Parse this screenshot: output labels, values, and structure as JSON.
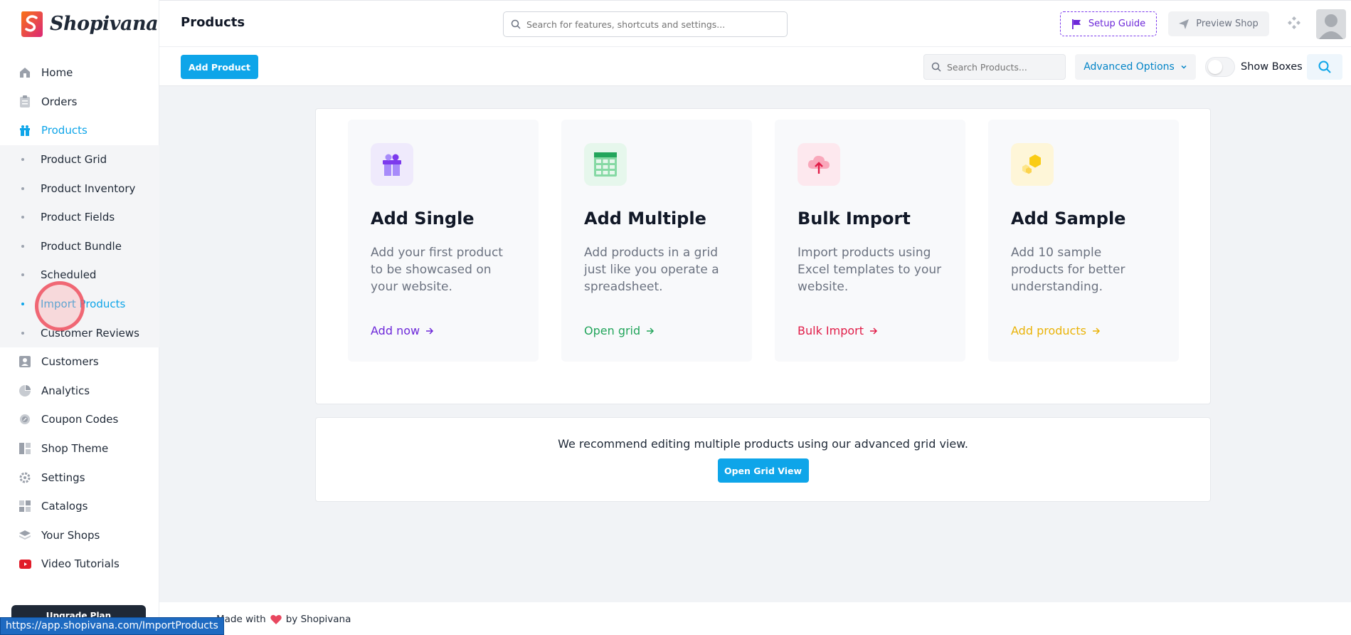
{
  "brand": {
    "name": "Shopivana"
  },
  "header": {
    "title": "Products",
    "search_placeholder": "Search for features, shortcuts and settings...",
    "setup_guide": "Setup Guide",
    "preview_shop": "Preview Shop"
  },
  "toolbar": {
    "add_product": "Add Product",
    "search_placeholder": "Search Products...",
    "advanced_options": "Advanced Options",
    "show_boxes": "Show Boxes"
  },
  "sidebar": {
    "items": [
      {
        "label": "Home",
        "icon": "home-icon"
      },
      {
        "label": "Orders",
        "icon": "clipboard-icon"
      },
      {
        "label": "Products",
        "icon": "gift-icon",
        "active": true
      },
      {
        "label": "Customers",
        "icon": "user-card-icon"
      },
      {
        "label": "Analytics",
        "icon": "pie-chart-icon"
      },
      {
        "label": "Coupon Codes",
        "icon": "badge-icon"
      },
      {
        "label": "Shop Theme",
        "icon": "layout-icon"
      },
      {
        "label": "Settings",
        "icon": "gear-icon"
      },
      {
        "label": "Catalogs",
        "icon": "grid-icon"
      },
      {
        "label": "Your Shops",
        "icon": "layers-icon"
      },
      {
        "label": "Video Tutorials",
        "icon": "youtube-icon"
      }
    ],
    "sub_items": [
      {
        "label": "Product Grid"
      },
      {
        "label": "Product Inventory"
      },
      {
        "label": "Product Fields"
      },
      {
        "label": "Product Bundle"
      },
      {
        "label": "Scheduled"
      },
      {
        "label": "Import Products",
        "active": true
      },
      {
        "label": "Customer Reviews"
      }
    ],
    "upgrade": "Upgrade Plan"
  },
  "cards": [
    {
      "title": "Add Single",
      "desc": "Add your first product to be showcased on your website.",
      "link": "Add now",
      "color": "#6d28d9",
      "icon": "gift-icon"
    },
    {
      "title": "Add Multiple",
      "desc": "Add products in a grid just like you operate a spreadsheet.",
      "link": "Open grid",
      "color": "#22a55b",
      "icon": "spreadsheet-icon"
    },
    {
      "title": "Bulk Import",
      "desc": "Import products using Excel templates to your website.",
      "link": "Bulk Import",
      "color": "#e11d48",
      "icon": "cloud-upload-icon"
    },
    {
      "title": "Add Sample",
      "desc": "Add 10 sample products for better understanding.",
      "link": "Add products",
      "color": "#eab308",
      "icon": "hexagon-icon"
    }
  ],
  "recommend": {
    "text": "We recommend editing multiple products using our advanced grid view.",
    "button": "Open Grid View"
  },
  "footer": {
    "made_with": "Made with",
    "by": "by Shopivana"
  },
  "status_url": "https://app.shopivana.com/ImportProducts",
  "colors": {
    "accent": "#0ea5e9",
    "purple": "#6d28d9",
    "green": "#22a55b",
    "red": "#e11d48",
    "yellow": "#eab308"
  }
}
